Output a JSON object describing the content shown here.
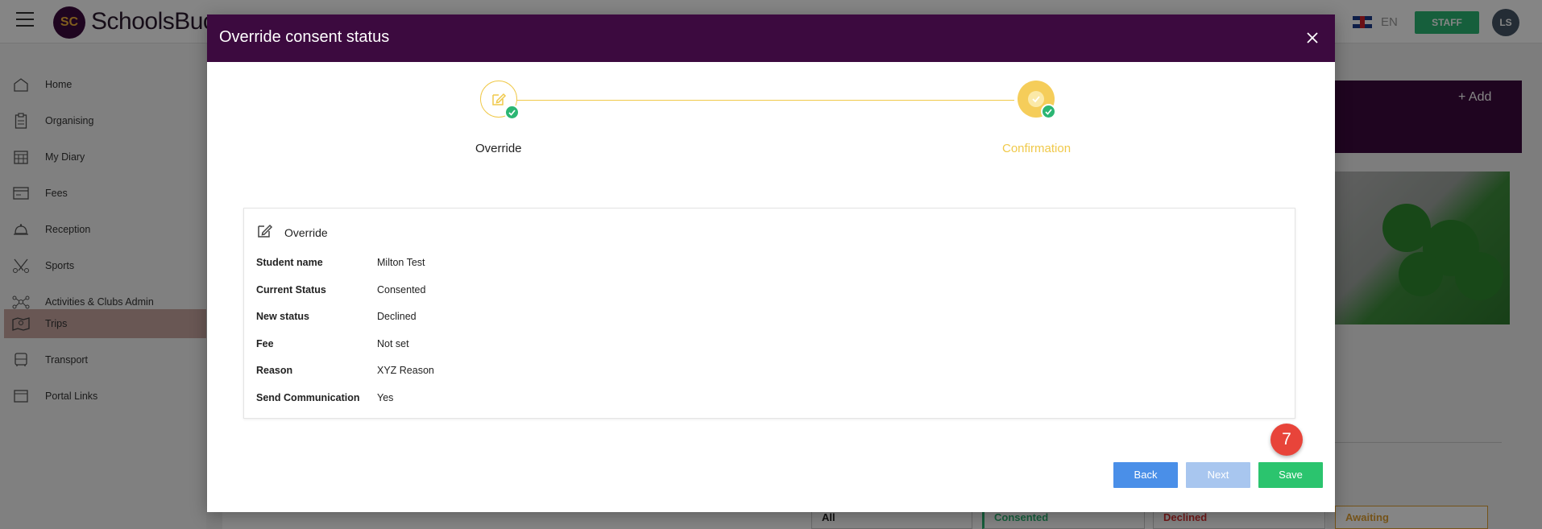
{
  "app": {
    "logo_initials": "SC",
    "logo_text": "SchoolsBuc",
    "language": "EN",
    "role_badge": "STAFF",
    "user_initials": "LS"
  },
  "sidebar": {
    "items": [
      {
        "label": "Home",
        "icon": "home-icon"
      },
      {
        "label": "Organising",
        "icon": "clipboard-icon"
      },
      {
        "label": "My Diary",
        "icon": "calendar-icon"
      },
      {
        "label": "Fees",
        "icon": "card-icon"
      },
      {
        "label": "Reception",
        "icon": "bell-icon"
      },
      {
        "label": "Sports",
        "icon": "sports-icon"
      },
      {
        "label": "Activities & Clubs Admin",
        "icon": "network-icon"
      },
      {
        "label": "Trips",
        "icon": "map-icon"
      },
      {
        "label": "Transport",
        "icon": "bus-icon"
      },
      {
        "label": "Portal Links",
        "icon": "window-icon"
      }
    ],
    "active_index": 7
  },
  "background": {
    "add_label": "+ Add",
    "cards": [
      "All",
      "Consented",
      "Declined",
      "Awaiting"
    ]
  },
  "modal": {
    "title": "Override consent status",
    "steps": [
      {
        "label": "Override",
        "state": "done"
      },
      {
        "label": "Confirmation",
        "state": "current"
      }
    ],
    "summary": {
      "heading": "Override",
      "rows": [
        {
          "key": "Student name",
          "value": "Milton Test"
        },
        {
          "key": "Current Status",
          "value": "Consented"
        },
        {
          "key": "New status",
          "value": "Declined"
        },
        {
          "key": "Fee",
          "value": "Not set"
        },
        {
          "key": "Reason",
          "value": "XYZ Reason"
        },
        {
          "key": "Send Communication",
          "value": "Yes"
        }
      ]
    },
    "buttons": {
      "back": "Back",
      "next": "Next",
      "save": "Save"
    }
  },
  "annotation": {
    "step_number": "7"
  },
  "colors": {
    "brand_purple": "#3c0a3f",
    "accent_yellow": "#f0c94a",
    "success_green": "#2bb673",
    "primary_blue": "#4a8fe8",
    "annotation_red": "#e8443a"
  }
}
